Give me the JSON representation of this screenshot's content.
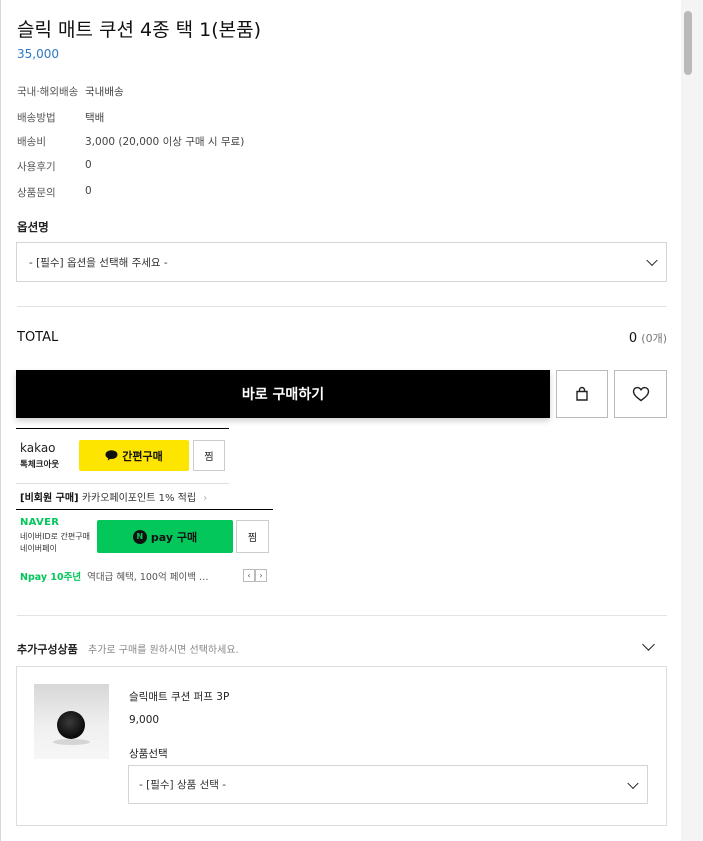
{
  "product": {
    "title": "슬릭 매트 쿠션 4종 택 1(본품)",
    "price": "35,000"
  },
  "info": [
    {
      "key": "국내·해외배송",
      "value": "국내배송"
    },
    {
      "key": "배송방법",
      "value": "택배"
    },
    {
      "key": "배송비",
      "value": "3,000 (20,000 이상 구매 시 무료)"
    },
    {
      "key": "사용후기",
      "value": "0"
    },
    {
      "key": "상품문의",
      "value": "0"
    }
  ],
  "option": {
    "label": "옵션명",
    "placeholder": "- [필수] 옵션을 선택해 주세요 -"
  },
  "total": {
    "label": "TOTAL",
    "amount": "0",
    "count": "(0개)"
  },
  "buttons": {
    "buy_now": "바로 구매하기",
    "cart_icon": "shopping-bag-icon",
    "wishlist_icon": "heart-icon"
  },
  "kakao": {
    "logo": "kakao",
    "sub": "톡체크아웃",
    "pay_label": "간편구매",
    "zzim": "찜",
    "note_bold": "[비회원 구매]",
    "note_text": "카카오페이포인트 1% 적립",
    "note_arrow": "›"
  },
  "naver": {
    "logo": "NAVER",
    "sub1": "네이버ID로 간편구매",
    "sub2": "네이버페이",
    "pay_logo": "N",
    "pay_label": "pay 구매",
    "zzim": "찜",
    "note_green": "Npay 10주년",
    "note_text": "역대급 혜택, 100억 페이백 …",
    "prev": "‹",
    "next": "›"
  },
  "addon": {
    "title": "추가구성상품",
    "hint": "추가로 구매를 원하시면 선택하세요.",
    "item": {
      "name": "슬릭매트 쿠션 퍼프 3P",
      "price": "9,000",
      "select_label": "상품선택",
      "select_placeholder": "- [필수] 상품 선택 -"
    }
  },
  "colors": {
    "price_blue": "#2d78c4",
    "kakao_yellow": "#fee500",
    "naver_green": "#03c75a",
    "buy_black": "#000000"
  }
}
